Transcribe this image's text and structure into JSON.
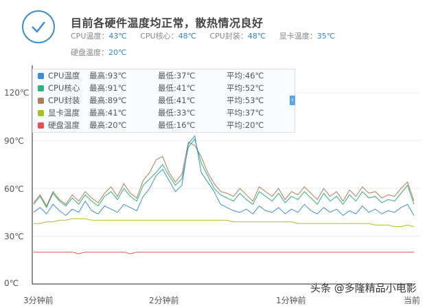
{
  "header": {
    "title": "目前各硬件温度均正常，散热情况良好",
    "stats": [
      {
        "label": "CPU温度：",
        "value": "43℃"
      },
      {
        "label": "CPU核心：",
        "value": "48℃"
      },
      {
        "label": "CPU封装：",
        "value": "48℃"
      },
      {
        "label": "显卡温度：",
        "value": "35℃"
      },
      {
        "label": "硬盘温度：",
        "value": "20℃"
      }
    ]
  },
  "legend": [
    {
      "name": "CPU温度",
      "max": "最高:93℃",
      "min": "最低:37℃",
      "avg": "平均:46℃",
      "color": "#3b8de0"
    },
    {
      "name": "CPU核心",
      "max": "最高:91℃",
      "min": "最低:41℃",
      "avg": "平均:52℃",
      "color": "#2bb57a"
    },
    {
      "name": "CPU封装",
      "max": "最高:89℃",
      "min": "最低:41℃",
      "avg": "平均:53℃",
      "color": "#b07d5a"
    },
    {
      "name": "显卡温度",
      "max": "最高:41℃",
      "min": "最低:33℃",
      "avg": "平均:37℃",
      "color": "#a6c21a"
    },
    {
      "name": "硬盘温度",
      "max": "最高:20℃",
      "min": "最低:16℃",
      "avg": "平均:20℃",
      "color": "#e85050"
    }
  ],
  "collapse_icon": "‹",
  "watermark": "头条 @多隆精品小电影",
  "chart_data": {
    "type": "line",
    "y_ticks": [
      "0℃",
      "30℃",
      "60℃",
      "90℃",
      "120℃"
    ],
    "ylim": [
      0,
      120
    ],
    "x_ticks": [
      "3分钟前",
      "2分钟前",
      "1分钟前",
      "当前"
    ],
    "series": [
      {
        "name": "CPU温度",
        "values": [
          45,
          48,
          44,
          50,
          46,
          43,
          47,
          45,
          52,
          46,
          44,
          49,
          47,
          45,
          50,
          48,
          46,
          55,
          60,
          68,
          72,
          65,
          58,
          62,
          88,
          93,
          70,
          64,
          58,
          50,
          48,
          46,
          45,
          47,
          44,
          49,
          46,
          45,
          48,
          44,
          47,
          45,
          50,
          46,
          44,
          48,
          45,
          47,
          43,
          46,
          44,
          49,
          45,
          47,
          44,
          46,
          45,
          48,
          50,
          43
        ]
      },
      {
        "name": "CPU核心",
        "values": [
          50,
          55,
          48,
          57,
          52,
          49,
          54,
          50,
          56,
          52,
          49,
          55,
          58,
          53,
          60,
          55,
          52,
          62,
          66,
          70,
          75,
          68,
          62,
          66,
          86,
          91,
          76,
          68,
          60,
          56,
          54,
          52,
          57,
          53,
          50,
          58,
          55,
          52,
          57,
          51,
          55,
          53,
          58,
          54,
          50,
          57,
          52,
          55,
          50,
          56,
          52,
          58,
          54,
          55,
          51,
          53,
          52,
          57,
          62,
          50
        ]
      },
      {
        "name": "CPU封装",
        "values": [
          51,
          56,
          49,
          58,
          53,
          50,
          56,
          52,
          58,
          54,
          51,
          57,
          61,
          55,
          63,
          57,
          54,
          65,
          70,
          78,
          80,
          70,
          64,
          69,
          89,
          87,
          80,
          70,
          63,
          58,
          57,
          55,
          60,
          56,
          52,
          61,
          58,
          55,
          60,
          53,
          58,
          56,
          61,
          57,
          53,
          60,
          55,
          58,
          52,
          59,
          55,
          61,
          57,
          58,
          54,
          56,
          55,
          60,
          64,
          52
        ]
      },
      {
        "name": "显卡温度",
        "values": [
          38,
          38,
          39,
          39,
          40,
          40,
          41,
          41,
          41,
          40,
          40,
          40,
          40,
          40,
          40,
          40,
          40,
          40,
          40,
          40,
          40,
          40,
          40,
          40,
          40,
          40,
          40,
          40,
          40,
          40,
          40,
          39,
          39,
          39,
          39,
          39,
          39,
          39,
          39,
          39,
          39,
          38,
          38,
          38,
          38,
          38,
          38,
          38,
          38,
          38,
          38,
          38,
          38,
          37,
          37,
          37,
          36,
          36,
          37,
          36
        ]
      },
      {
        "name": "硬盘温度",
        "values": [
          20,
          20,
          20,
          20,
          20,
          20,
          20,
          19,
          20,
          20,
          20,
          20,
          20,
          20,
          20,
          19,
          20,
          20,
          20,
          20,
          20,
          20,
          20,
          20,
          20,
          20,
          20,
          20,
          20,
          20,
          20,
          20,
          20,
          20,
          20,
          20,
          20,
          20,
          20,
          20,
          20,
          20,
          20,
          20,
          20,
          20,
          20,
          20,
          20,
          20,
          20,
          20,
          20,
          20,
          20,
          20,
          20,
          20,
          20,
          20
        ]
      }
    ]
  }
}
